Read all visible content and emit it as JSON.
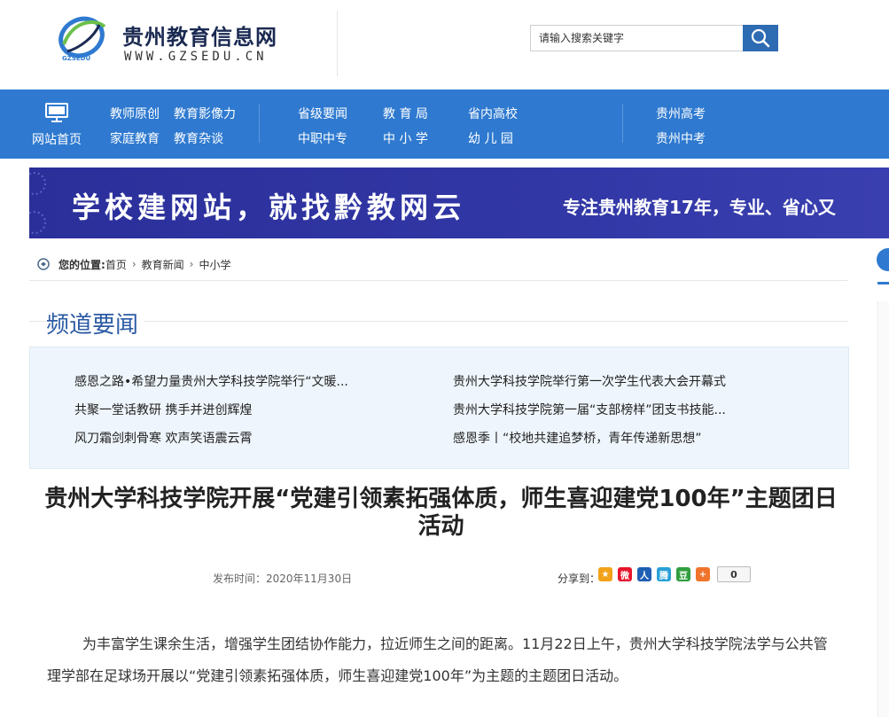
{
  "site": {
    "title": "贵州教育信息网",
    "url": "WWW.GZSEDU.CN",
    "logo_text": "GZSEDU",
    "colors": {
      "primary": "#2f7ad0",
      "title": "#1b2a52",
      "channel": "#2b5aa3"
    }
  },
  "search": {
    "placeholder": "请输入搜索关键字",
    "button_icon": "search-icon"
  },
  "nav": {
    "home": {
      "label": "网站首页",
      "icon": "monitor-icon"
    },
    "group1": [
      "教师原创",
      "教育影像力",
      "家庭教育",
      "教育杂谈"
    ],
    "group2": [
      "省级要闻",
      "教 育 局",
      "省内高校",
      "中职中专",
      "中 小 学",
      "幼 儿 园"
    ],
    "group3": [
      "贵州高考",
      "贵州中考"
    ]
  },
  "banner": {
    "main": "学校建网站，就找黔教网云",
    "sub": "专注贵州教育17年，专业、省心又"
  },
  "breadcrumb": {
    "prefix": "您的位置:",
    "items": [
      "首页",
      "教育新闻",
      "中小学"
    ]
  },
  "channel": {
    "title": "频道要闻",
    "news": [
      "感恩之路•希望力量贵州大学科技学院举行“文暖...",
      "贵州大学科技学院举行第一次学生代表大会开幕式",
      "共聚一堂话教研 携手并进创辉煌",
      "贵州大学科技学院第一届“支部榜样”团支书技能...",
      "风刀霜剑刺骨寒 欢声笑语震云霄",
      "感恩季丨“校地共建追梦桥，青年传递新思想”"
    ]
  },
  "article": {
    "title": "贵州大学科技学院开展“党建引领素拓强体质，师生喜迎建党100年”主题团日活动",
    "date_label": "发布时间：2020年11月30日",
    "share_label": "分享到：",
    "share_count": "0",
    "share_icons": [
      {
        "name": "qzone-share-icon",
        "glyph": "★",
        "color": "#f2a21a"
      },
      {
        "name": "weibo-share-icon",
        "glyph": "微",
        "color": "#e6162d"
      },
      {
        "name": "renren-share-icon",
        "glyph": "人",
        "color": "#1f5fb4"
      },
      {
        "name": "tencent-weibo-share-icon",
        "glyph": "腾",
        "color": "#2aa0d8"
      },
      {
        "name": "douban-share-icon",
        "glyph": "豆",
        "color": "#2f9e3e"
      },
      {
        "name": "more-share-icon",
        "glyph": "+",
        "color": "#f0742b"
      }
    ],
    "body": "为丰富学生课余生活，增强学生团结协作能力，拉近师生之间的距离。11月22日上午，贵州大学科技学院法学与公共管理学部在足球场开展以“党建引领素拓强体质，师生喜迎建党100年”为主题的主题团日活动。"
  }
}
